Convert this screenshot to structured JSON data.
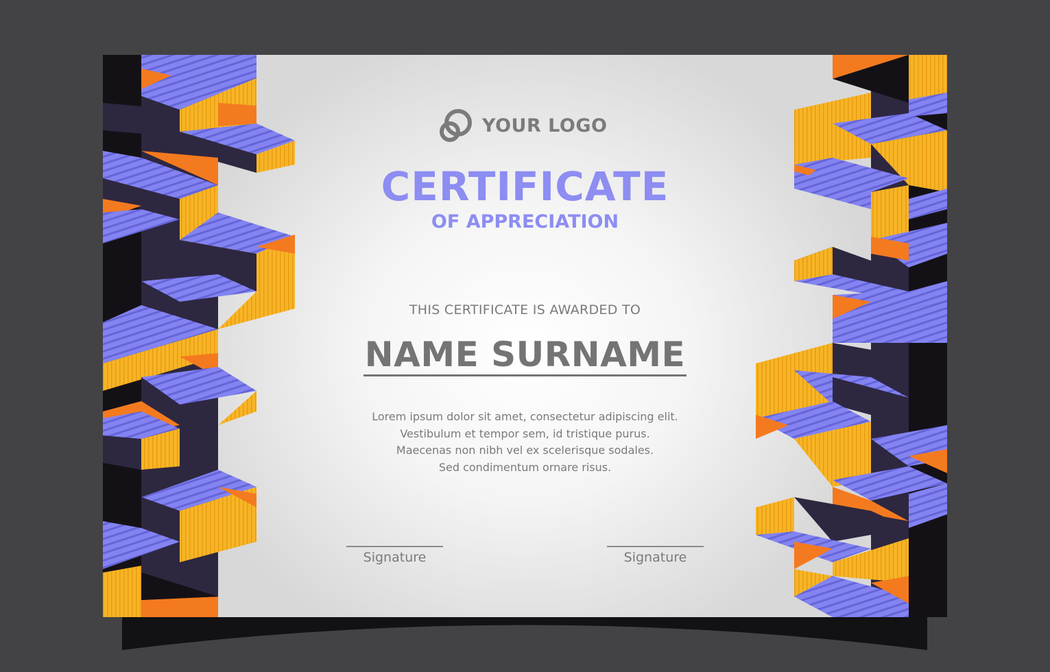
{
  "logo": {
    "icon": "linked-rings-logo-icon",
    "text": "YOUR LOGO"
  },
  "certificate": {
    "title": "CERTIFICATE",
    "subtitle": "OF APPRECIATION",
    "awarded_to": "THIS CERTIFICATE IS AWARDED TO",
    "recipient": "NAME SURNAME",
    "body_lines": [
      "Lorem ipsum dolor sit amet, consectetur adipiscing elit.",
      "Vestibulum et tempor sem, id tristique purus.",
      "Maecenas non nibh vel ex scelerisque sodales.",
      "Sed condimentum ornare risus."
    ]
  },
  "signatures": [
    {
      "label": "Signature"
    },
    {
      "label": "Signature"
    }
  ],
  "colors": {
    "background": "#434345",
    "accent_purple": "#8d8df2",
    "stripe_purple": "#7b7bf0",
    "yellow": "#f7b526",
    "orange": "#f47a1f",
    "dark": "#2e2740",
    "black": "#141116",
    "text_gray": "#7a7a7a"
  }
}
